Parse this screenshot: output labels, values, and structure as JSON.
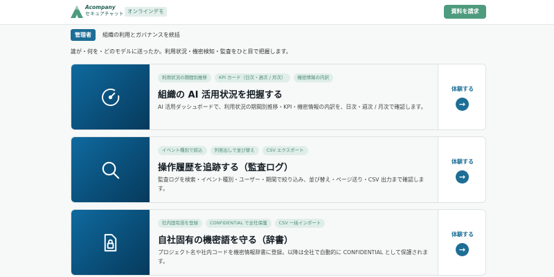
{
  "header": {
    "brand_name": "Acompany",
    "brand_sub": "セキュアチャット",
    "demo_tag": "オンラインデモ",
    "cta_label": "資料を請求",
    "logo_icon": "triangle-logo-icon"
  },
  "role": {
    "badge": "管理者",
    "description": "組織の利用とガバナンスを統括"
  },
  "lead": "誰が・何を・どのモデルに送ったか。利用状況・機密検知・監査をひと目で把握します。",
  "colors": {
    "accent_blue": "#1d6e96",
    "accent_green": "#4e9b7f",
    "tag_bg": "#dfeee8"
  },
  "cards": [
    {
      "icon": "gauge-icon",
      "tags": [
        "利用状況の期間別推移",
        "KPI カード（日次・週次 / 月次）",
        "機密情報の内訳"
      ],
      "title": "組織の AI 活用状況を把握する",
      "desc": "AI 活用ダッシュボードで、利用状況の期間別推移・KPI・機密情報の内訳を、日次・週次 / 月次で確認します。",
      "action_label": "体験する",
      "action_icon": "arrow-right-icon"
    },
    {
      "icon": "search-icon",
      "tags": [
        "イベント種別で絞込",
        "列見出しで並び替え",
        "CSV エクスポート"
      ],
      "title": "操作履歴を追跡する（監査ログ）",
      "desc": "監査ログを検索・イベント種別・ユーザー・期間で絞り込み、並び替え・ページ送り・CSV 出力まで確認します。",
      "action_label": "体験する",
      "action_icon": "arrow-right-icon"
    },
    {
      "icon": "lock-document-icon",
      "tags": [
        "社内固有語を登録",
        "CONFIDENTIAL で全社保護",
        "CSV 一括インポート"
      ],
      "title": "自社固有の機密語を守る（辞書）",
      "desc": "プロジェクト名や社内コードを機密情報辞書に登録。以降は全社で自動的に CONFIDENTIAL として保護されます。",
      "action_label": "体験する",
      "action_icon": "arrow-right-icon"
    }
  ]
}
